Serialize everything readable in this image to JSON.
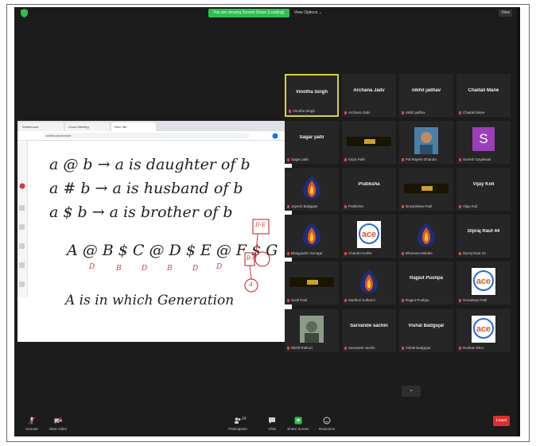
{
  "topbar": {
    "share_banner": "You are viewing Screen Share (Loading)",
    "view_options": "View Options ⌄",
    "view_button": "View"
  },
  "browser": {
    "tabs": [
      "Whiteboard",
      "Zoom Meeting",
      "New Tab"
    ],
    "address": "whiteboard/online"
  },
  "whiteboard": {
    "lines": [
      "a @ b → a is daughter of b",
      "a # b → a is husband of b",
      "a $ b → a is brother of b",
      "A @ B $ C @ D $ E @ F $ G",
      "A is in which Generation"
    ],
    "letters_under": [
      "D",
      "B",
      "D",
      "B",
      "D",
      "D"
    ],
    "annotations": [
      "D·E",
      "B·C",
      "A"
    ]
  },
  "participants": [
    {
      "name": "Vinotha Singh",
      "label": "Vinotha Singh",
      "active": true,
      "kind": "name"
    },
    {
      "name": "Archana Jadv",
      "label": "Archana Jadv",
      "kind": "name"
    },
    {
      "name": "nikhil jadhav",
      "label": "nikhil jadhav",
      "kind": "name"
    },
    {
      "name": "Chaitali Mane",
      "label": "Chaitali Mane",
      "kind": "name"
    },
    {
      "name": "Sagar patil",
      "label": "Sagar patil",
      "kind": "name"
    },
    {
      "name": "",
      "label": "Kirpa Patil",
      "kind": "camera"
    },
    {
      "name": "",
      "label": "Pal Rajesh Dhanda",
      "kind": "photo"
    },
    {
      "name": "",
      "label": "Suresh Gayakwar",
      "kind": "avatar",
      "avatar_letter": "S"
    },
    {
      "name": "",
      "label": "Jayesh Badgujar",
      "kind": "logo-fire"
    },
    {
      "name": "Pratiksha",
      "label": "Pratiksha",
      "kind": "name"
    },
    {
      "name": "",
      "label": "Dnyandeep Patil",
      "kind": "camera"
    },
    {
      "name": "Vijay Koli",
      "label": "Vijay Koli",
      "kind": "name"
    },
    {
      "name": "",
      "label": "Bhagyashri Sonage",
      "kind": "logo-fire"
    },
    {
      "name": "",
      "label": "Chandni Kolhe",
      "kind": "logo-ace"
    },
    {
      "name": "",
      "label": "Bhavana Mahale",
      "kind": "logo-fire"
    },
    {
      "name": "Dipraj Raut 44",
      "label": "Dipraj Raut 44",
      "kind": "name"
    },
    {
      "name": "",
      "label": "Sunil Patil",
      "kind": "camera"
    },
    {
      "name": "",
      "label": "Madhuri Kulkarni",
      "kind": "logo-fire"
    },
    {
      "name": "Rajput Pushpa",
      "label": "Rajput Pushpa",
      "kind": "name"
    },
    {
      "name": "",
      "label": "Gurudeep Patil",
      "kind": "logo-ace"
    },
    {
      "name": "",
      "label": "Nikhil Rathod",
      "kind": "photo2"
    },
    {
      "name": "Sarvande sachin",
      "label": "Sarvande sachin",
      "kind": "name"
    },
    {
      "name": "Vishal Badgujar",
      "label": "Vishal Badgujar",
      "kind": "name"
    },
    {
      "name": "",
      "label": "Roshan Bhor",
      "kind": "logo-ace"
    }
  ],
  "more_button": "⌄",
  "bottombar": {
    "mute": "Unmute",
    "video": "Start Video",
    "participants": "Participants",
    "participants_count": "24",
    "chat": "Chat",
    "share": "Share Screen",
    "reactions": "Reactions",
    "end": "Leave"
  },
  "colors": {
    "active_speaker": "#d6d33b",
    "share_banner": "#2fbf4f",
    "end_button": "#d9302f",
    "ink_red": "#d23b3b",
    "avatar_purple": "#9b3fb8"
  }
}
